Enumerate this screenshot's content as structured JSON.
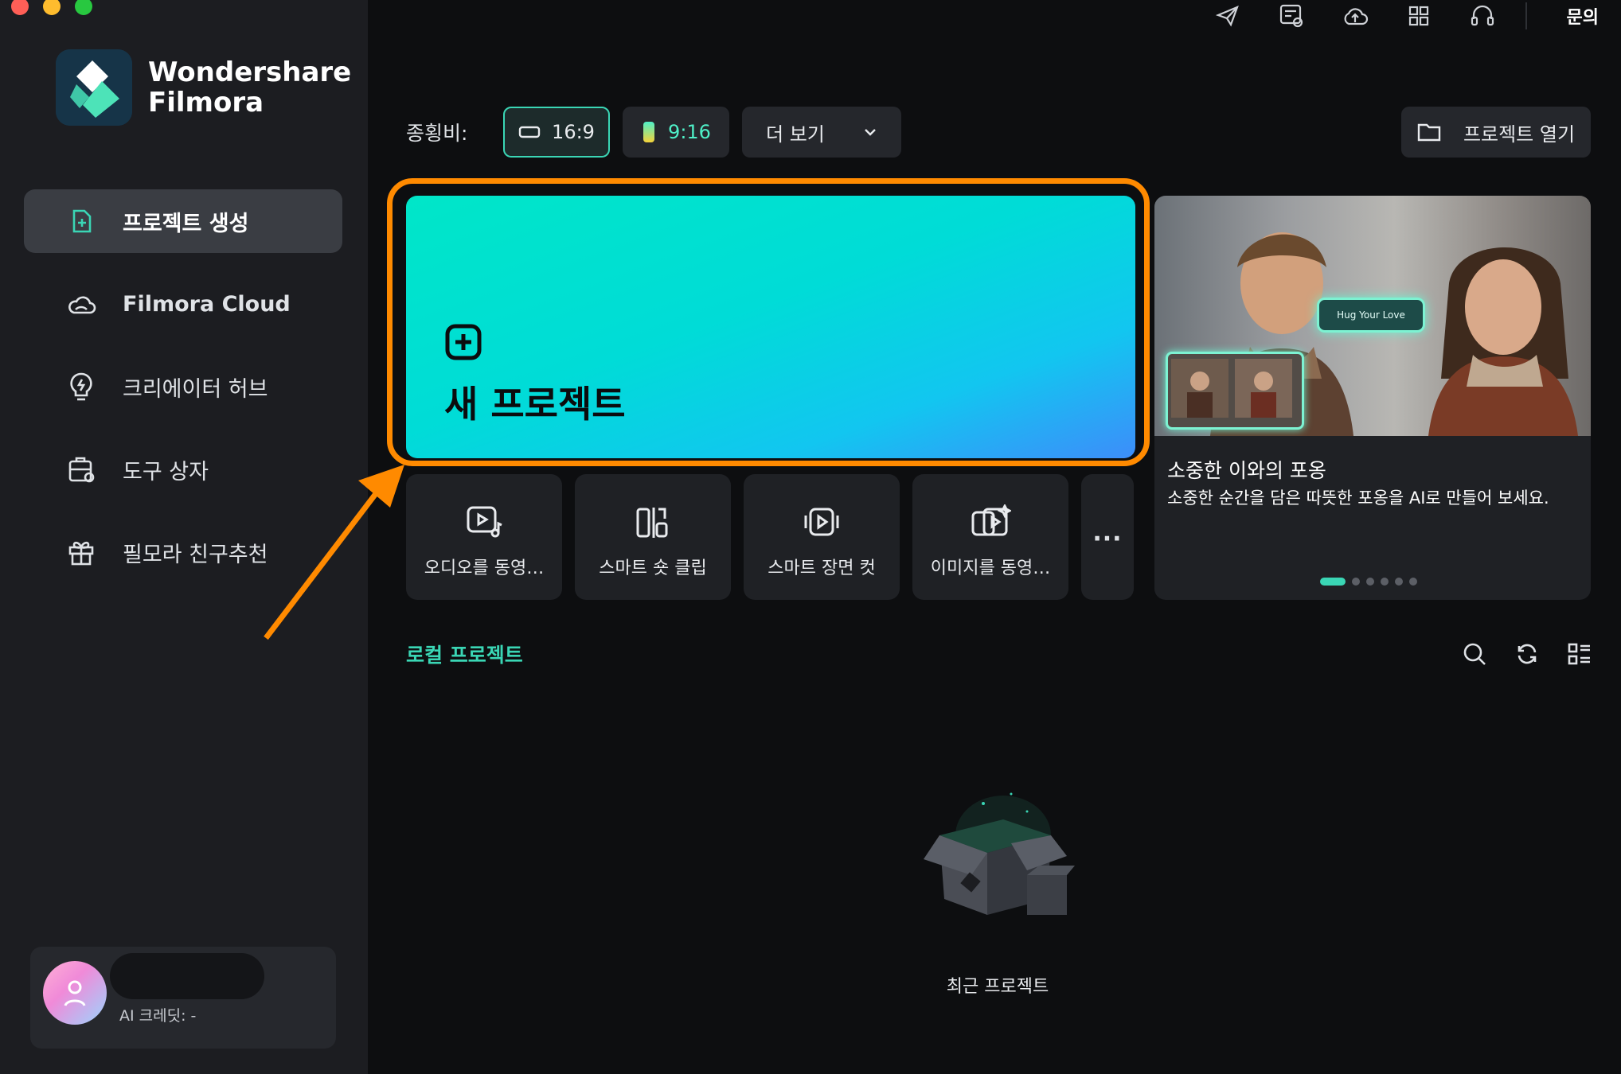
{
  "app": {
    "brand_line1": "Wondershare",
    "brand_line2": "Filmora"
  },
  "sidebar": {
    "items": [
      {
        "label": "프로젝트 생성",
        "icon": "add-file-icon"
      },
      {
        "label": "Filmora Cloud",
        "icon": "cloud-icon"
      },
      {
        "label": "크리에이터 허브",
        "icon": "lightbulb-icon"
      },
      {
        "label": "도구 상자",
        "icon": "toolbox-icon"
      },
      {
        "label": "필모라 친구추천",
        "icon": "gift-icon"
      }
    ],
    "account": {
      "credits": "AI 크레딧: -"
    }
  },
  "topbar": {
    "icons": [
      "send-icon",
      "feedback-icon",
      "cloud-upload-icon",
      "grid-icon",
      "headset-icon"
    ],
    "inquiry": "문의"
  },
  "ratio": {
    "label": "종횡비:",
    "option_169": "16:9",
    "option_916": "9:16",
    "more": "더 보기",
    "open_project": "프로젝트 열기"
  },
  "new_project": {
    "title": "새 프로젝트"
  },
  "tools": [
    {
      "label": "오디오를 동영…",
      "icon": "audio-to-video-icon"
    },
    {
      "label": "스마트 숏 클립",
      "icon": "smart-short-clip-icon"
    },
    {
      "label": "스마트 장면 컷",
      "icon": "smart-scene-cut-icon"
    },
    {
      "label": "이미지를 동영…",
      "icon": "image-to-video-icon"
    },
    {
      "label": "···",
      "icon": "more-icon"
    }
  ],
  "banner": {
    "tag": "Hug Your Love",
    "title": "소중한 이와의 포옹",
    "subtitle": "소중한 순간을 담은 따뜻한 포옹을 AI로 만들어 보세요.",
    "page_count": 6,
    "active_page": 1
  },
  "local": {
    "title": "로컬 프로젝트",
    "empty_label": "최근 프로젝트"
  },
  "colors": {
    "accent": "#3ad6b5",
    "highlight": "#ff8a00",
    "background": "#0d0e10",
    "sidebar": "#1c1d21"
  }
}
